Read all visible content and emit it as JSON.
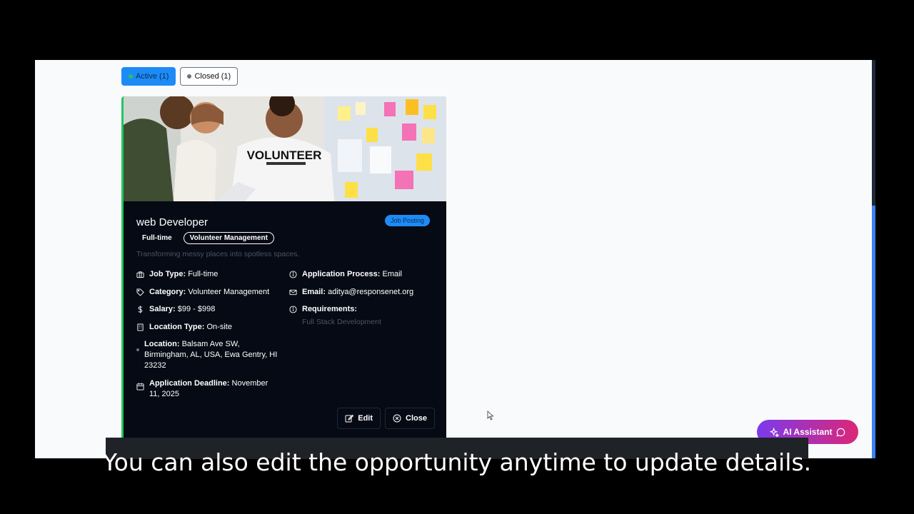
{
  "filters": {
    "active_label": "Active (1)",
    "closed_label": "Closed (1)"
  },
  "card": {
    "photo_shirt_text": "VOLUNTEER",
    "title": "web Developer",
    "badge": "Job Posting",
    "tags": [
      "Full-time",
      "Volunteer Management"
    ],
    "description": "Transforming messy places into spotless spaces.",
    "left_details": [
      {
        "label": "Job Type:",
        "value": "Full-time",
        "icon": "briefcase-icon"
      },
      {
        "label": "Category:",
        "value": "Volunteer Management",
        "icon": "tag-icon"
      },
      {
        "label": "Salary:",
        "value": "$99 - $998",
        "icon": "dollar-icon"
      },
      {
        "label": "Location Type:",
        "value": "On-site",
        "icon": "building-icon"
      },
      {
        "label": "Location:",
        "value": "Balsam Ave SW, Birmingham, AL, USA, Ewa Gentry, HI 23232",
        "icon": "map-pin-icon"
      },
      {
        "label": "Application Deadline:",
        "value": "November 11, 2025",
        "icon": "calendar-icon"
      }
    ],
    "right_details": [
      {
        "label": "Application Process:",
        "value": "Email",
        "icon": "info-icon"
      },
      {
        "label": "Email:",
        "value": "aditya@responsenet.org",
        "icon": "mail-icon"
      },
      {
        "label": "Requirements:",
        "value": "",
        "icon": "info-icon"
      }
    ],
    "requirements_text": "Full Stack Development",
    "edit_label": "Edit",
    "close_label": "Close"
  },
  "ai_assistant_label": "AI Assistant",
  "caption": "You can also edit the opportunity anytime to update details.",
  "colors": {
    "accent_blue": "#1d8bf5",
    "card_bg": "#050a14",
    "active_border": "#22c55e",
    "ai_gradient_start": "#7c3aed",
    "ai_gradient_end": "#db2777"
  }
}
